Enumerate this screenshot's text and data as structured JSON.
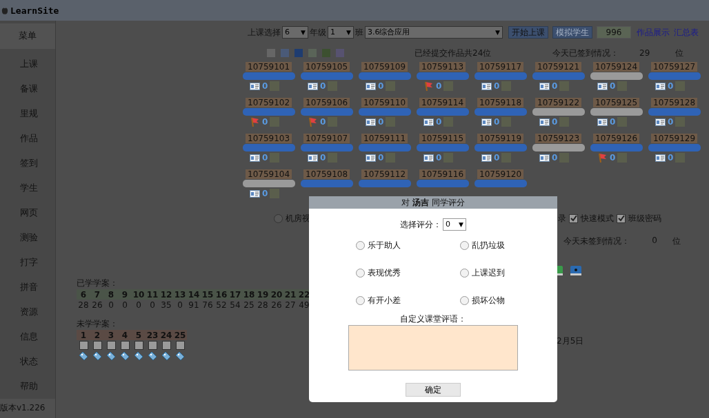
{
  "header": {
    "logo": "LearnSite"
  },
  "sidebar": {
    "title": "菜单",
    "items": [
      "上课",
      "备课",
      "里规",
      "作品",
      "签到",
      "学生",
      "网页",
      "测验",
      "打字",
      "拼音",
      "资源",
      "信息",
      "状态",
      "帮助"
    ],
    "version": "版本v1.226"
  },
  "toolbar": {
    "course_label": "上课选择",
    "grade_select": {
      "value": "6",
      "arrow": "▼"
    },
    "grade_label": "年级",
    "class_select": {
      "value": "1",
      "arrow": "▼"
    },
    "class_label": "班",
    "lesson_select": {
      "value": "3.6综合应用",
      "arrow": "▼"
    },
    "start_button": "开始上课",
    "simulate_button": {
      "label": "模拟学生",
      "disabled": true
    },
    "code_value": "996",
    "links": [
      "作品展示",
      "汇总表"
    ]
  },
  "summary": {
    "legend": [
      {
        "color": "#666666"
      },
      {
        "color": "#4a5a78"
      },
      {
        "color": "#1e3c70"
      },
      {
        "color": "#5a6458"
      },
      {
        "color": "#3c5030"
      },
      {
        "color": "#575270"
      }
    ],
    "submitted": "已经提交作品共24位",
    "signed_label": "今天已签到情况：",
    "signed_count": "29",
    "signed_unit": "位"
  },
  "student_rows": [
    [
      {
        "id": "10759101",
        "color": "#2f63b6",
        "kind": "card",
        "count": "0"
      },
      {
        "id": "10759105",
        "color": "#2f63b6",
        "kind": "card",
        "count": "0"
      },
      {
        "id": "10759109",
        "color": "#2f63b6",
        "kind": "card",
        "count": "0"
      },
      {
        "id": "10759113",
        "color": "#2f63b6",
        "kind": "flag",
        "count": "0"
      },
      {
        "id": "10759117",
        "color": "#2f63b6",
        "kind": "card",
        "count": "0"
      },
      {
        "id": "10759121",
        "color": "#2f63b6",
        "kind": "card",
        "count": "0"
      },
      {
        "id": "10759124",
        "color": "#9a9a9a",
        "kind": "card",
        "count": "0"
      },
      {
        "id": "10759127",
        "color": "#2f63b6",
        "kind": "card",
        "count": "0"
      }
    ],
    [
      {
        "id": "10759102",
        "color": "#2f63b6",
        "kind": "flag",
        "count": "0"
      },
      {
        "id": "10759106",
        "color": "#2f63b6",
        "kind": "flag",
        "count": "0"
      },
      {
        "id": "10759110",
        "color": "#2f63b6",
        "kind": "card",
        "count": "0"
      },
      {
        "id": "10759114",
        "color": "#2f63b6",
        "kind": "card",
        "count": "0"
      },
      {
        "id": "10759118",
        "color": "#2f63b6",
        "kind": "card",
        "count": "0"
      },
      {
        "id": "10759122",
        "color": "#9a9a9a",
        "kind": "card",
        "count": "0"
      },
      {
        "id": "10759125",
        "color": "#9a9a9a",
        "kind": "card",
        "count": "0"
      },
      {
        "id": "10759128",
        "color": "#2f63b6",
        "kind": "card",
        "count": "0"
      }
    ],
    [
      {
        "id": "10759103",
        "color": "#2f63b6",
        "kind": "card",
        "count": "0"
      },
      {
        "id": "10759107",
        "color": "#2f63b6",
        "kind": "card",
        "count": "0"
      },
      {
        "id": "10759111",
        "color": "#2f63b6",
        "kind": "card",
        "count": "0"
      },
      {
        "id": "10759115",
        "color": "#2f63b6",
        "kind": "card",
        "count": "0"
      },
      {
        "id": "10759119",
        "color": "#2f63b6",
        "kind": "card",
        "count": "0"
      },
      {
        "id": "10759123",
        "color": "#9a9a9a",
        "kind": "card",
        "count": "0"
      },
      {
        "id": "10759126",
        "color": "#2f63b6",
        "kind": "flag",
        "count": "0"
      },
      {
        "id": "10759129",
        "color": "#2f63b6",
        "kind": "card",
        "count": "0"
      }
    ],
    [
      {
        "id": "10759104",
        "color": "#9a9a9a",
        "kind": "card",
        "count": "0"
      },
      {
        "id": "10759108",
        "color": "#2f63b6"
      },
      {
        "id": "10759112",
        "color": "#2f63b6"
      },
      {
        "id": "10759116",
        "color": "#2f63b6"
      },
      {
        "id": "10759120",
        "color": "#2f63b6"
      }
    ]
  ],
  "options": {
    "radio": {
      "label": "机房视",
      "selected": false
    },
    "cut_label": "录",
    "checkboxes": [
      {
        "label": "快速模式",
        "checked": true
      },
      {
        "label": "班级密码",
        "checked": true
      }
    ]
  },
  "unsigned": {
    "label": "今天未签到情况：",
    "count": "0",
    "unit": "位"
  },
  "date_fragment": "2月5日",
  "learned": {
    "title": "已学学案：",
    "columns": [
      {
        "num": "6",
        "count": "28"
      },
      {
        "num": "7",
        "count": "26"
      },
      {
        "num": "8",
        "count": "0"
      },
      {
        "num": "9",
        "count": "0"
      },
      {
        "num": "10",
        "count": "0"
      },
      {
        "num": "11",
        "count": "0"
      },
      {
        "num": "12",
        "count": "35"
      },
      {
        "num": "13",
        "count": "0"
      },
      {
        "num": "14",
        "count": "91"
      },
      {
        "num": "15",
        "count": "76"
      },
      {
        "num": "16",
        "count": "52"
      },
      {
        "num": "17",
        "count": "54"
      },
      {
        "num": "18",
        "count": "25"
      },
      {
        "num": "19",
        "count": "28"
      },
      {
        "num": "20",
        "count": "26"
      },
      {
        "num": "21",
        "count": "27"
      },
      {
        "num": "22",
        "count": "49"
      }
    ]
  },
  "unlearned": {
    "title": "未学学案：",
    "items": [
      {
        "num": "1",
        "checked": false
      },
      {
        "num": "2",
        "checked": false
      },
      {
        "num": "3",
        "checked": false
      },
      {
        "num": "4",
        "checked": false
      },
      {
        "num": "5",
        "checked": false
      },
      {
        "num": "23",
        "checked": false
      },
      {
        "num": "24",
        "checked": false
      },
      {
        "num": "25",
        "checked": false
      }
    ]
  },
  "dialog": {
    "title": "对 **汤吉** 同学评分",
    "score_label": "选择评分：",
    "score_select": {
      "value": "0",
      "arrow": "▼"
    },
    "options": [
      {
        "label": "乐于助人",
        "selected": false
      },
      {
        "label": "乱扔垃圾",
        "selected": false
      },
      {
        "label": "表现优秀",
        "selected": false
      },
      {
        "label": "上课迟到",
        "selected": false
      },
      {
        "label": "有开小差",
        "selected": false
      },
      {
        "label": "损坏公物",
        "selected": false
      }
    ],
    "comment_label": "自定义课堂评语：",
    "confirm_button": "确定"
  }
}
